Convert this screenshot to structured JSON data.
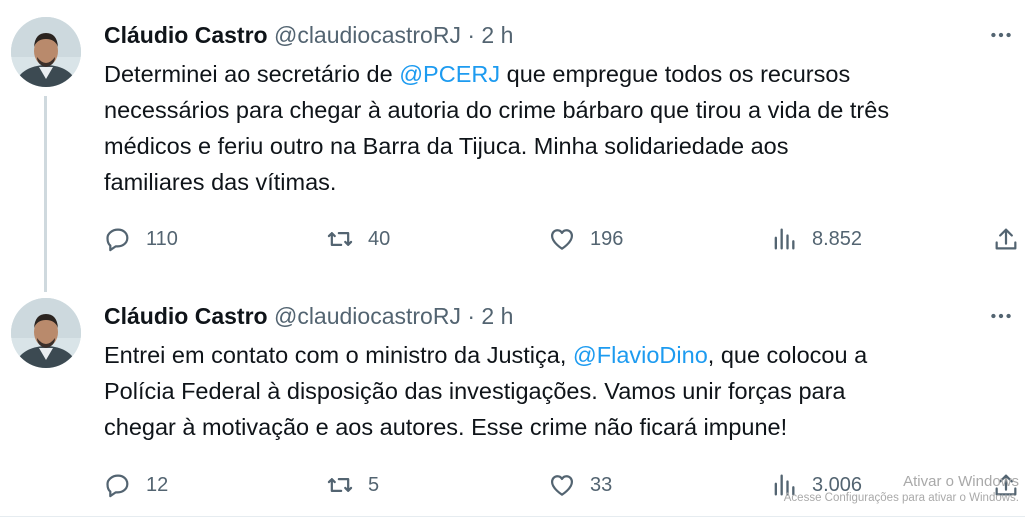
{
  "tweets": [
    {
      "author": {
        "name": "Cláudio Castro",
        "handle": "@claudiocastroRJ",
        "time": "2 h"
      },
      "text_lines": [
        [
          "Determinei ao secretário de ",
          "@PCERJ",
          " que empregue todos os recursos"
        ],
        [
          "necessários para chegar à autoria do crime bárbaro que tirou a vida de três"
        ],
        [
          "médicos e feriu outro na Barra da Tijuca. Minha solidariedade aos"
        ],
        [
          "familiares das vítimas."
        ]
      ],
      "replies": "110",
      "retweets": "40",
      "likes": "196",
      "views": "8.852"
    },
    {
      "author": {
        "name": "Cláudio Castro",
        "handle": "@claudiocastroRJ",
        "time": "2 h"
      },
      "text_lines": [
        [
          "Entrei em contato com o ministro da Justiça, ",
          "@FlavioDino",
          ", que colocou a"
        ],
        [
          "Polícia Federal à disposição das investigações. Vamos unir forças para"
        ],
        [
          "chegar à motivação e aos autores. Esse crime não ficará impune!"
        ]
      ],
      "replies": "12",
      "retweets": "5",
      "likes": "33",
      "views": "3.006"
    }
  ],
  "separator": "·",
  "more_icon": "…",
  "watermark": {
    "line1": "Ativar o Windows",
    "line2": "Acesse Configurações para ativar o Windows."
  },
  "colors": {
    "text": "#0f1419",
    "muted": "#536471",
    "mention": "#1d9bf0",
    "thread": "#cfd9de",
    "watermark": "#a9a9a9"
  }
}
